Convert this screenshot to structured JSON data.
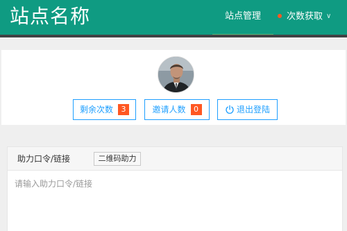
{
  "header": {
    "site_title": "站点名称",
    "nav": {
      "manage_label": "站点管理",
      "fetch_label": "次数获取",
      "fetch_chevron": "∨"
    }
  },
  "profile": {
    "avatar_icon": "user-avatar-photo",
    "remaining": {
      "label": "剩余次数",
      "count": "3"
    },
    "invited": {
      "label": "邀请人数",
      "count": "0"
    },
    "logout": {
      "label": "退出登陆",
      "icon": "power-icon"
    }
  },
  "command_panel": {
    "label": "助力口令/链接",
    "qr_button_label": "二维码助力",
    "input_placeholder": "请输入助力口令/链接",
    "input_value": ""
  },
  "colors": {
    "header_bg": "#0f9b82",
    "accent_blue": "#1e9fff",
    "badge_orange": "#ff5722",
    "active_underline": "#5fb878"
  }
}
